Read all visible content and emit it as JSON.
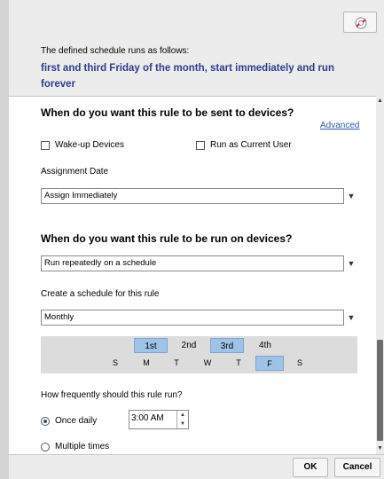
{
  "summary": {
    "intro": "The defined schedule runs as follows:",
    "text": "first and third Friday of the month, start immediately and run forever"
  },
  "send": {
    "heading": "When do you want this rule to be sent to devices?",
    "advanced_link": "Advanced",
    "wakeup_label": "Wake-up Devices",
    "run_as_user_label": "Run as Current User",
    "assignment_label": "Assignment Date",
    "assignment_value": "Assign Immediately"
  },
  "run": {
    "heading": "When do you want this rule to be run on devices?",
    "mode_value": "Run repeatedly on a schedule",
    "schedule_label": "Create a schedule for this rule",
    "frequency_value": "Monthly",
    "weeks": [
      {
        "label": "1st",
        "selected": true
      },
      {
        "label": "2nd",
        "selected": false
      },
      {
        "label": "3rd",
        "selected": true
      },
      {
        "label": "4th",
        "selected": false
      }
    ],
    "days": [
      {
        "label": "S",
        "selected": false
      },
      {
        "label": "M",
        "selected": false
      },
      {
        "label": "T",
        "selected": false
      },
      {
        "label": "W",
        "selected": false
      },
      {
        "label": "T",
        "selected": false
      },
      {
        "label": "F",
        "selected": true
      },
      {
        "label": "S",
        "selected": false
      }
    ],
    "how_often_label": "How frequently should this rule run?",
    "once_daily_label": "Once daily",
    "time_value": "3:00 AM",
    "multiple_times_label": "Multiple times"
  },
  "footer": {
    "ok_label": "OK",
    "cancel_label": "Cancel"
  },
  "icons": {
    "help": "help-lifebuoy-icon",
    "dropdown": "triangle-down-icon"
  },
  "colors": {
    "summary_text": "#2e3d8a",
    "link": "#2f5cb5",
    "selection": "#9fc3e6"
  }
}
